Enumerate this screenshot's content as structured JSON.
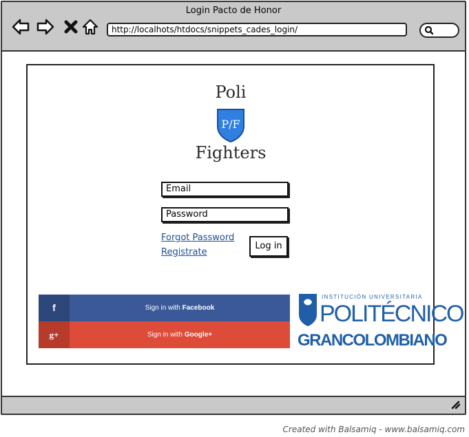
{
  "window": {
    "title": "Login Pacto de Honor",
    "url": "http://localhots/htdocs/snippets_cades_login/"
  },
  "logo": {
    "line1": "Poli",
    "badge": "P/F",
    "line2": "Fighters"
  },
  "form": {
    "email_placeholder": "Email",
    "password_placeholder": "Password",
    "forgot_password": "Forgot Password",
    "register": "Registrate",
    "login_button": "Log in"
  },
  "social": {
    "facebook_icon": "f",
    "facebook_prefix": "Sign in with ",
    "facebook_brand": "Facebook",
    "google_icon": "g+",
    "google_prefix": "Sign in with ",
    "google_brand": "Google+",
    "facebook_color": "#3b5998",
    "google_color": "#dd4b39"
  },
  "partner": {
    "subtitle": "INSTITUCIÓN UNIVERSITARIA",
    "name": "POLITÉCNICO",
    "name2": "GRANCOLOMBIANO",
    "color": "#1f5fa8"
  },
  "footer": {
    "credit": "Created with Balsamiq - www.balsamiq.com"
  }
}
